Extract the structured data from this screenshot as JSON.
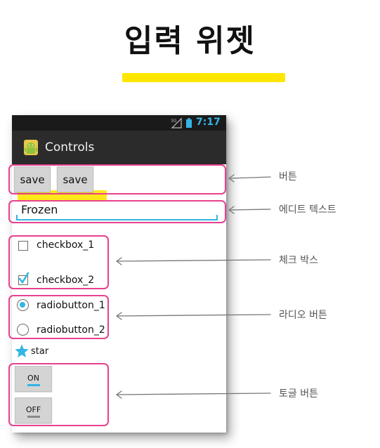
{
  "slide": {
    "title": "입력 위젯",
    "underline_color": "#ffe600",
    "annotation_color": "#e8418e"
  },
  "status_bar": {
    "network": "3G",
    "clock": "7:17"
  },
  "app": {
    "icon": "android-icon",
    "title": "Controls"
  },
  "buttons": {
    "save1_label": "save",
    "save2_label": "save"
  },
  "edit_text": {
    "value": "Frozen"
  },
  "checkboxes": [
    {
      "label": "checkbox_1",
      "checked": false
    },
    {
      "label": "checkbox_2",
      "checked": true
    }
  ],
  "radios": [
    {
      "label": "radiobutton_1",
      "selected": true
    },
    {
      "label": "radiobutton_2",
      "selected": false
    }
  ],
  "star": {
    "icon": "star-icon",
    "label": "star"
  },
  "toggles": [
    {
      "label": "ON",
      "state": true
    },
    {
      "label": "OFF",
      "state": false
    }
  ],
  "annotations": {
    "button": "버튼",
    "edit_text": "에디트 텍스트",
    "checkbox": "체크 박스",
    "radio": "라디오 버튼",
    "toggle": "토글 버튼"
  },
  "accent_color": "#33b5e5"
}
